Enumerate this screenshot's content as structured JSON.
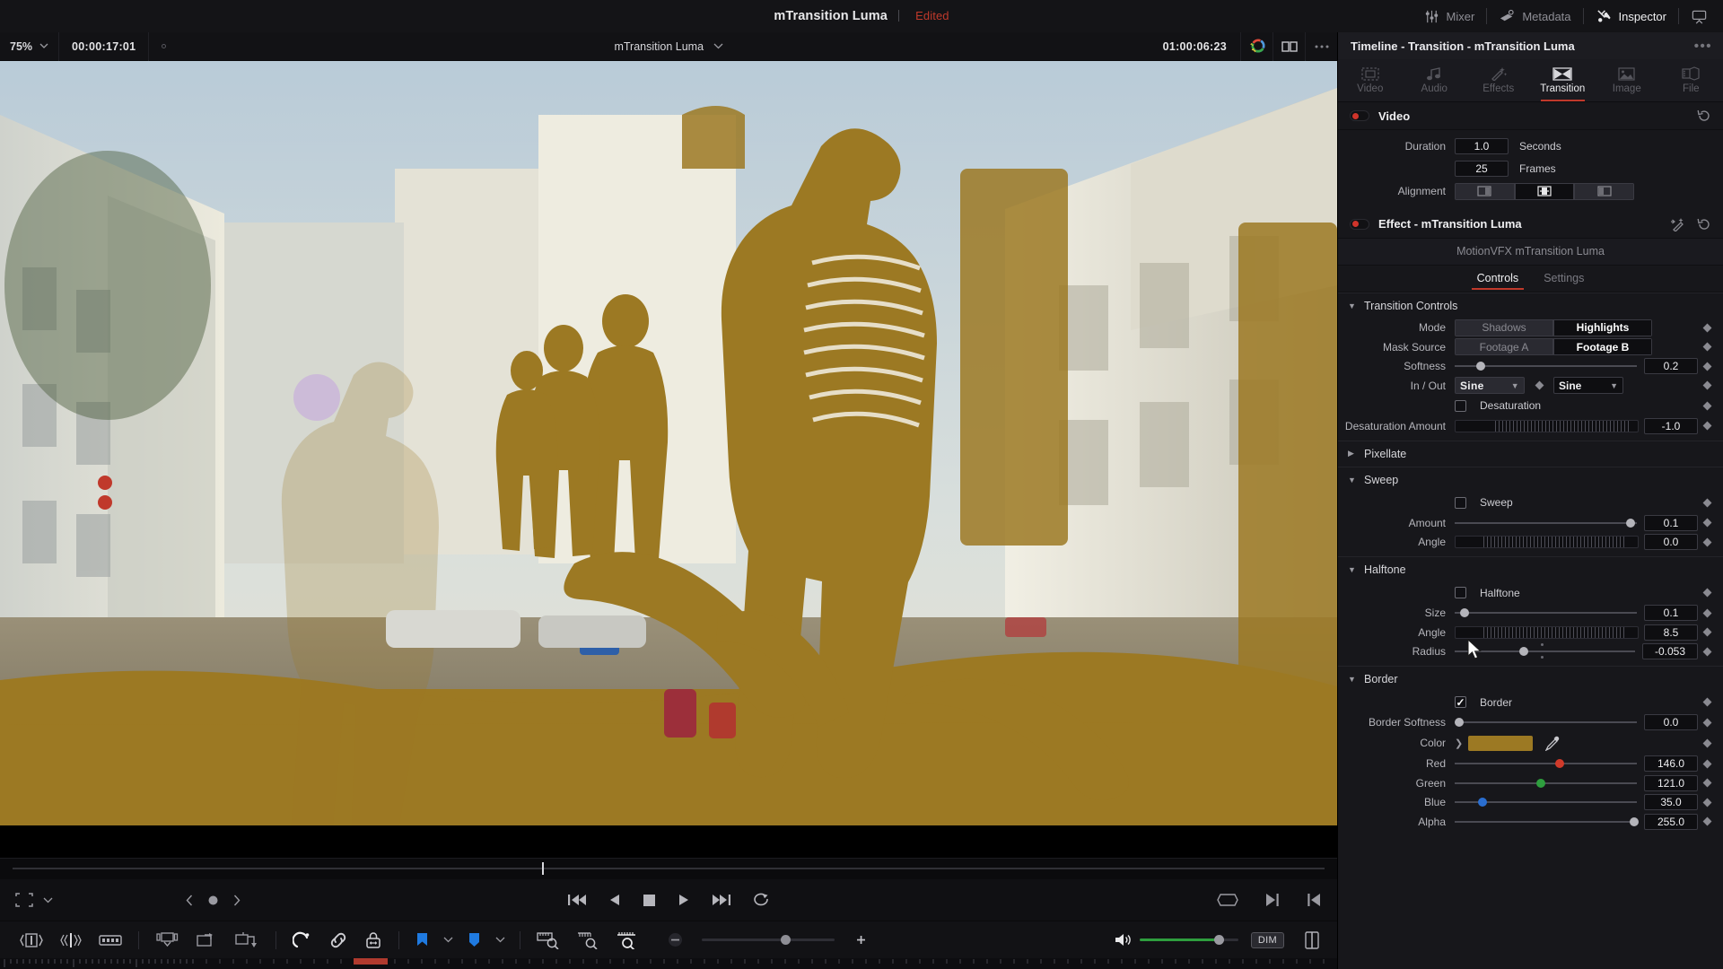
{
  "titlebar": {
    "project_title": "mTransition Luma",
    "status": "Edited",
    "buttons": [
      {
        "label": "Mixer",
        "icon": "mixer-icon",
        "active": false
      },
      {
        "label": "Metadata",
        "icon": "metadata-icon",
        "active": false
      },
      {
        "label": "Inspector",
        "icon": "inspector-icon",
        "active": true
      }
    ]
  },
  "viewer_bar": {
    "zoom_level": "75%",
    "timecode_left": "00:00:17:01",
    "clip_name": "mTransition Luma",
    "timecode_right": "01:00:06:23",
    "color_icon": "color-wheel-icon",
    "split_icon": "split-screen-icon",
    "options_icon": "more-options-icon"
  },
  "transport": {
    "frame_icon": "safe-area-icon",
    "prev_icon": "prev-marker-icon",
    "dot_icon": "marker-dot-icon",
    "next_icon": "next-marker-icon",
    "buttons": [
      {
        "name": "jump-to-start-button",
        "icon": "skip-back-icon"
      },
      {
        "name": "play-reverse-button",
        "icon": "play-reverse-icon"
      },
      {
        "name": "stop-button",
        "icon": "stop-icon"
      },
      {
        "name": "play-button",
        "icon": "play-icon"
      },
      {
        "name": "jump-to-end-button",
        "icon": "skip-forward-icon"
      },
      {
        "name": "loop-button",
        "icon": "loop-icon"
      }
    ],
    "right_icons": [
      "fit-screen-icon",
      "next-edit-icon",
      "prev-edit-icon"
    ]
  },
  "toolbar": {
    "left_tools": [
      "trim-in-out-icon",
      "slip-icon",
      "razor-icon"
    ],
    "edit_tools": [
      "insert-clip-icon",
      "overwrite-clip-icon",
      "replace-clip-icon"
    ],
    "mode_tools": [
      "dynamic-trim-icon",
      "link-clips-icon",
      "lock-track-icon"
    ],
    "markers": [
      {
        "icon": "flag-icon",
        "color": "#1f7ae0"
      },
      {
        "icon": "marker-icon",
        "color": "#1f7ae0"
      }
    ],
    "zoom_tools": [
      "fit-timeline-icon",
      "detail-zoom-icon",
      "custom-zoom-icon"
    ],
    "zoom_out_label": "−",
    "zoom_in_label": "+",
    "volume_icon": "speaker-icon",
    "dim_label": "DIM",
    "panel_icon": "panel-toggle-icon"
  },
  "inspector": {
    "panel_title": "Timeline - Transition - mTransition Luma",
    "more_icon": "more-options-icon",
    "tabs": [
      {
        "label": "Video",
        "icon": "video-icon",
        "active": false
      },
      {
        "label": "Audio",
        "icon": "audio-icon",
        "active": false
      },
      {
        "label": "Effects",
        "icon": "effects-icon",
        "active": false
      },
      {
        "label": "Transition",
        "icon": "transition-icon",
        "active": true
      },
      {
        "label": "Image",
        "icon": "image-icon",
        "active": false
      },
      {
        "label": "File",
        "icon": "file-icon",
        "active": false
      }
    ],
    "video_section": {
      "title": "Video",
      "reset_icon": "reset-icon",
      "duration_label": "Duration",
      "duration_seconds": "1.0",
      "seconds_label": "Seconds",
      "duration_frames": "25",
      "frames_label": "Frames",
      "alignment_label": "Alignment",
      "alignment_options": [
        "end-on-edit-icon",
        "center-on-edit-icon",
        "start-on-edit-icon"
      ],
      "alignment_selected": 1
    },
    "effect_section": {
      "title": "Effect - mTransition Luma",
      "wand_icon": "magic-wand-icon",
      "reset_icon": "reset-icon",
      "plugin_name": "MotionVFX mTransition Luma",
      "tabs": [
        {
          "label": "Controls",
          "active": true
        },
        {
          "label": "Settings",
          "active": false
        }
      ]
    },
    "groups": [
      {
        "name": "Transition Controls",
        "expanded": true,
        "rows": [
          {
            "type": "segment",
            "label": "Mode",
            "options": [
              "Shadows",
              "Highlights"
            ],
            "selected": 1
          },
          {
            "type": "segment",
            "label": "Mask Source",
            "options": [
              "Footage A",
              "Footage B"
            ],
            "selected": 1
          },
          {
            "type": "slider",
            "label": "Softness",
            "value": "0.2",
            "pos": 12
          },
          {
            "type": "dual-select",
            "label": "In / Out",
            "value_a": "Sine",
            "value_b": "Sine"
          },
          {
            "type": "checkbox",
            "label": "",
            "text": "Desaturation",
            "checked": false
          },
          {
            "type": "dial",
            "label": "Desaturation Amount",
            "value": "-1.0"
          }
        ]
      },
      {
        "name": "Pixellate",
        "expanded": false,
        "rows": []
      },
      {
        "name": "Sweep",
        "expanded": true,
        "rows": [
          {
            "type": "checkbox",
            "label": "",
            "text": "Sweep",
            "checked": false
          },
          {
            "type": "slider",
            "label": "Amount",
            "value": "0.1",
            "pos": 96
          },
          {
            "type": "dial",
            "label": "Angle",
            "value": "0.0"
          }
        ]
      },
      {
        "name": "Halftone",
        "expanded": true,
        "rows": [
          {
            "type": "checkbox",
            "label": "",
            "text": "Halftone",
            "checked": false
          },
          {
            "type": "slider",
            "label": "Size",
            "value": "0.1",
            "pos": 3
          },
          {
            "type": "dial",
            "label": "Angle",
            "value": "8.5"
          },
          {
            "type": "slider",
            "label": "Radius",
            "value": "-0.053",
            "pos": 36
          }
        ]
      },
      {
        "name": "Border",
        "expanded": true,
        "rows": [
          {
            "type": "checkbox",
            "label": "",
            "text": "Border",
            "checked": true
          },
          {
            "type": "slider",
            "label": "Border Softness",
            "value": "0.0",
            "pos": 0
          },
          {
            "type": "color",
            "label": "Color",
            "swatch": "#9c7923",
            "picker_icon": "eyedropper-icon"
          },
          {
            "type": "slider",
            "label": "Red",
            "value": "146.0",
            "pos": 57,
            "knob": "r"
          },
          {
            "type": "slider",
            "label": "Green",
            "value": "121.0",
            "pos": 47,
            "knob": "g"
          },
          {
            "type": "slider",
            "label": "Blue",
            "value": "35.0",
            "pos": 14,
            "knob": "b"
          },
          {
            "type": "slider",
            "label": "Alpha",
            "value": "255.0",
            "pos": 100
          }
        ]
      }
    ]
  },
  "colors": {
    "accent_red": "#c0392b",
    "border_color": "#9c7923",
    "blue_marker": "#1f7ae0",
    "volume_green": "#2e9e3e"
  }
}
